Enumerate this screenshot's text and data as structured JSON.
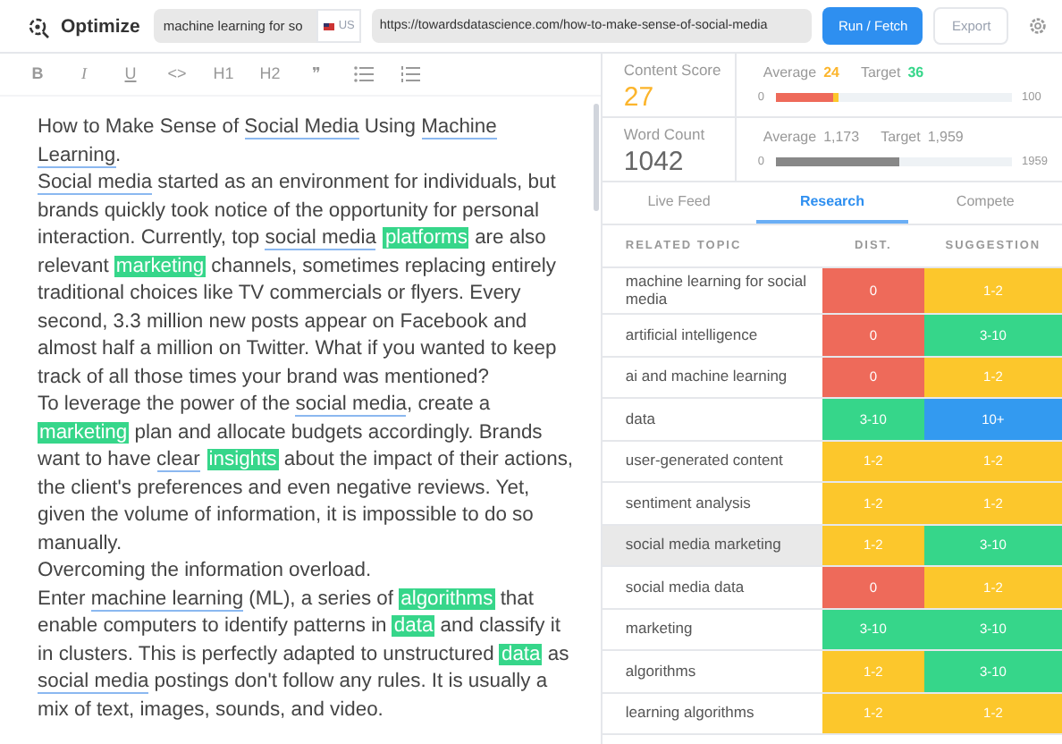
{
  "app": {
    "name": "Optimize"
  },
  "keyword": {
    "value": "machine learning for so",
    "country": "US"
  },
  "url": {
    "value": "https://towardsdatascience.com/how-to-make-sense-of-social-media"
  },
  "buttons": [
    {
      "label": "Run / Fetch",
      "kind": "primary"
    },
    {
      "label": "Export",
      "kind": "secondary"
    }
  ],
  "toolbar": [
    {
      "label": "B",
      "kind": "bold"
    },
    {
      "label": "I",
      "kind": "italic"
    },
    {
      "label": "U",
      "kind": "underline"
    },
    {
      "label": "<>",
      "kind": "text"
    },
    {
      "label": "H1",
      "kind": "text"
    },
    {
      "label": "H2",
      "kind": "text"
    },
    {
      "label": "❞",
      "kind": "text"
    },
    {
      "kind": "bullets"
    },
    {
      "kind": "numbered"
    }
  ],
  "document": [
    [
      {
        "t": "How to Make Sense of ",
        "kind": "plain"
      },
      {
        "t": "Social Media",
        "kind": "topic"
      },
      {
        "t": " Using ",
        "kind": "plain"
      },
      {
        "t": "Machine Learning",
        "kind": "topic"
      },
      {
        "t": ".",
        "kind": "plain"
      }
    ],
    [
      {
        "t": "Social media",
        "kind": "topic"
      },
      {
        "t": " started as an environment for individuals, but brands quickly took notice of the opportunity for personal interaction. Currently, top ",
        "kind": "plain"
      },
      {
        "t": "social media",
        "kind": "topic"
      },
      {
        "t": "platforms",
        "kind": "term"
      },
      {
        "t": " are also relevant ",
        "kind": "plain"
      },
      {
        "t": "marketing",
        "kind": "term"
      },
      {
        "t": " channels, sometimes replacing entirely traditional choices like TV commercials or flyers. Every second, 3.3 million new posts appear on Facebook and almost half a million on Twitter. What if you wanted to keep track of all those times your brand was mentioned?",
        "kind": "plain"
      }
    ],
    [
      {
        "t": "To leverage the power of the ",
        "kind": "plain"
      },
      {
        "t": "social media",
        "kind": "topic"
      },
      {
        "t": ", create a ",
        "kind": "plain"
      },
      {
        "t": "marketing",
        "kind": "term"
      },
      {
        "t": " plan and allocate budgets accordingly. Brands want to have ",
        "kind": "plain"
      },
      {
        "t": "clear",
        "kind": "topic"
      },
      {
        "t": "insights",
        "kind": "term"
      },
      {
        "t": " about the impact of their actions, the client's preferences and even negative reviews. Yet, given the volume of information, it is impossible to do so manually.",
        "kind": "plain"
      }
    ],
    [
      {
        "t": "Overcoming the information overload.",
        "kind": "plain"
      }
    ],
    [
      {
        "t": "Enter ",
        "kind": "plain"
      },
      {
        "t": "machine learning",
        "kind": "topic"
      },
      {
        "t": " (ML), a series of ",
        "kind": "plain"
      },
      {
        "t": "algorithms",
        "kind": "term"
      },
      {
        "t": " that enable computers to identify patterns in ",
        "kind": "plain"
      },
      {
        "t": "data",
        "kind": "term"
      },
      {
        "t": " and classify it in clusters. This is perfectly adapted to unstructured ",
        "kind": "plain"
      },
      {
        "t": "data",
        "kind": "term"
      },
      {
        "t": " as ",
        "kind": "plain"
      },
      {
        "t": "social media",
        "kind": "topic"
      },
      {
        "t": " postings don't follow any rules. It is usually a mix of text, images, sounds, and video.",
        "kind": "plain"
      }
    ]
  ],
  "scores": [
    {
      "label": "Content Score",
      "value": "27",
      "average_label": "Average",
      "average": "24",
      "target_label": "Target",
      "target": "36",
      "min": "0",
      "max": "100",
      "level": 0.27,
      "kind": "score"
    },
    {
      "label": "Word Count",
      "value": "1042",
      "average_label": "Average",
      "average": "1,173",
      "target_label": "Target",
      "target": "1,959",
      "min": "0",
      "max": "1959",
      "level": 0.53,
      "kind": "count"
    }
  ],
  "tabs": [
    {
      "label": "Live Feed",
      "selected": false
    },
    {
      "label": "Research",
      "selected": true
    },
    {
      "label": "Compete",
      "selected": false
    }
  ],
  "table": {
    "columns": [
      "RELATED TOPIC",
      "DIST.",
      "SUGGESTION"
    ],
    "rows": [
      {
        "selected": false,
        "cells": [
          {
            "text": "machine learning for social media"
          },
          {
            "text": "0",
            "color": "#ee6a5a"
          },
          {
            "text": "1-2",
            "color": "#fcc72c"
          }
        ]
      },
      {
        "selected": false,
        "cells": [
          {
            "text": "artificial intelligence"
          },
          {
            "text": "0",
            "color": "#ee6a5a"
          },
          {
            "text": "3-10",
            "color": "#36d68a"
          }
        ]
      },
      {
        "selected": false,
        "cells": [
          {
            "text": "ai and machine learning"
          },
          {
            "text": "0",
            "color": "#ee6a5a"
          },
          {
            "text": "1-2",
            "color": "#fcc72c"
          }
        ]
      },
      {
        "selected": false,
        "cells": [
          {
            "text": "data"
          },
          {
            "text": "3-10",
            "color": "#36d68a"
          },
          {
            "text": "10+",
            "color": "#339af0"
          }
        ]
      },
      {
        "selected": false,
        "cells": [
          {
            "text": "user-generated content"
          },
          {
            "text": "1-2",
            "color": "#fcc72c"
          },
          {
            "text": "1-2",
            "color": "#fcc72c"
          }
        ]
      },
      {
        "selected": false,
        "cells": [
          {
            "text": "sentiment analysis"
          },
          {
            "text": "1-2",
            "color": "#fcc72c"
          },
          {
            "text": "1-2",
            "color": "#fcc72c"
          }
        ]
      },
      {
        "selected": true,
        "cells": [
          {
            "text": "social media marketing"
          },
          {
            "text": "1-2",
            "color": "#fcc72c"
          },
          {
            "text": "3-10",
            "color": "#36d68a"
          }
        ]
      },
      {
        "selected": false,
        "cells": [
          {
            "text": "social media data"
          },
          {
            "text": "0",
            "color": "#ee6a5a"
          },
          {
            "text": "1-2",
            "color": "#fcc72c"
          }
        ]
      },
      {
        "selected": false,
        "cells": [
          {
            "text": "marketing"
          },
          {
            "text": "3-10",
            "color": "#36d68a"
          },
          {
            "text": "3-10",
            "color": "#36d68a"
          }
        ]
      },
      {
        "selected": false,
        "cells": [
          {
            "text": "algorithms"
          },
          {
            "text": "1-2",
            "color": "#fcc72c"
          },
          {
            "text": "3-10",
            "color": "#36d68a"
          }
        ]
      },
      {
        "selected": false,
        "cells": [
          {
            "text": "learning algorithms"
          },
          {
            "text": "1-2",
            "color": "#fcc72c"
          },
          {
            "text": "1-2",
            "color": "#fcc72c"
          }
        ]
      }
    ]
  }
}
